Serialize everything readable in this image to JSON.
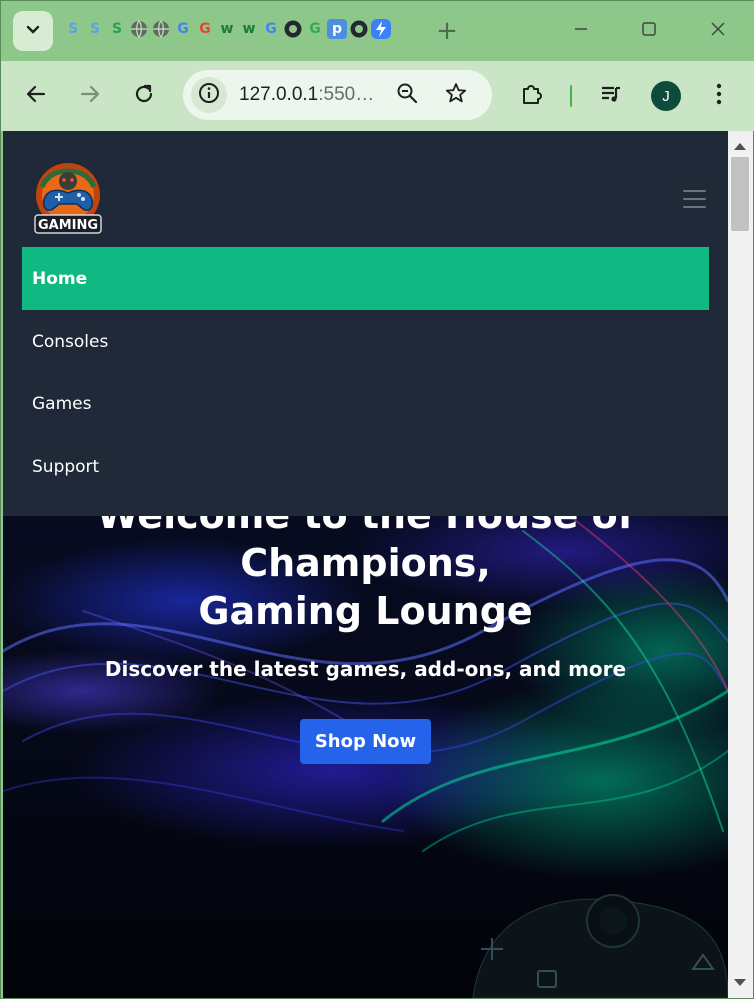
{
  "browser": {
    "url_main": "127.0.0.1",
    "url_rest": ":550…",
    "profile_initial": "J",
    "new_tab_label": "+"
  },
  "colors": {
    "nav_bg": "#1f2937",
    "nav_active": "#10b981",
    "button_primary": "#2563eb"
  },
  "logo": {
    "text": "GAMING"
  },
  "nav": {
    "items": [
      {
        "label": "Home",
        "active": true
      },
      {
        "label": "Consoles",
        "active": false
      },
      {
        "label": "Games",
        "active": false
      },
      {
        "label": "Support",
        "active": false
      }
    ]
  },
  "hero": {
    "title_line1": "Welcome to the House of",
    "title_line2": "Champions,",
    "title_line3": "Gaming Lounge",
    "subtitle": "Discover the latest games, add-ons, and more",
    "cta_label": "Shop Now"
  }
}
